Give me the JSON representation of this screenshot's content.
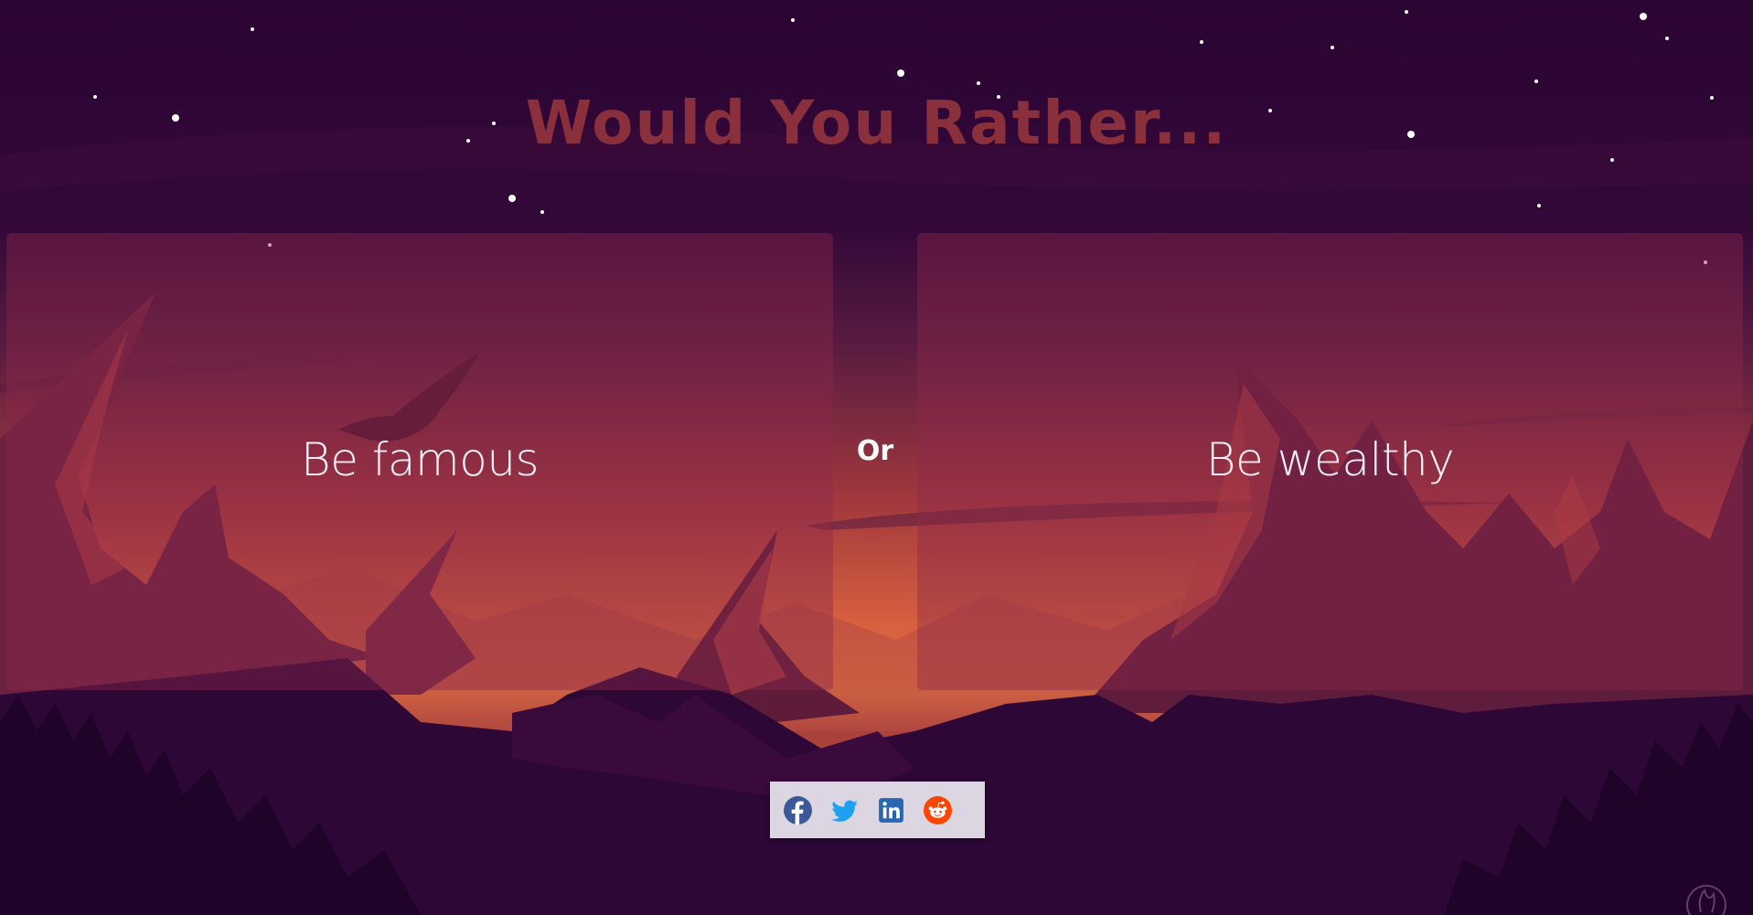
{
  "page": {
    "title": "Would You Rather...",
    "or_label": "Or"
  },
  "options": {
    "left": {
      "label": "Be famous"
    },
    "right": {
      "label": "Be wealthy"
    }
  },
  "share": {
    "buttons": [
      {
        "icon": "facebook-icon",
        "color": "#3b5998"
      },
      {
        "icon": "twitter-icon",
        "color": "#1da1f2"
      },
      {
        "icon": "linkedin-icon",
        "color": "#2867b2"
      },
      {
        "icon": "reddit-icon",
        "color": "#ff4500"
      }
    ]
  },
  "colors": {
    "title": "#8a2f3c",
    "sky": "#2b0633",
    "card_overlay": "#8c284b",
    "share_bar": "#dcd6e2"
  }
}
